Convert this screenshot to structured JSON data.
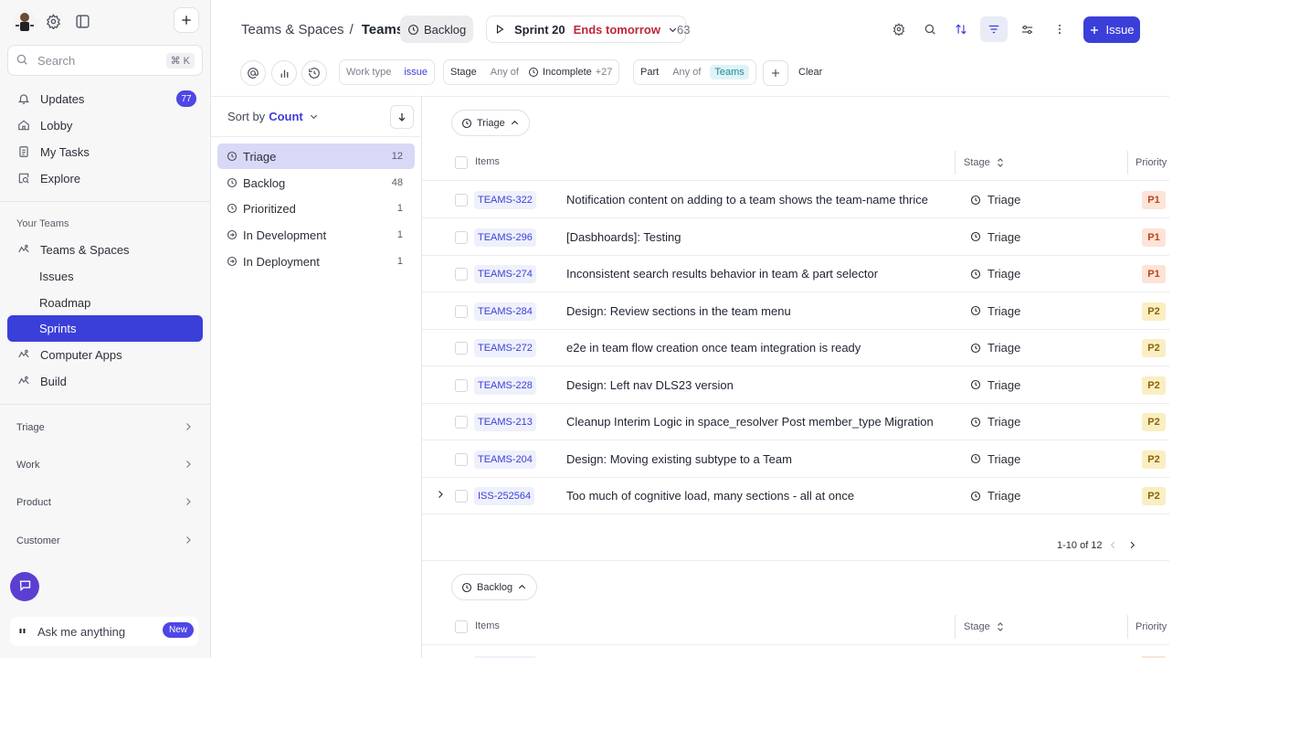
{
  "sidebar": {
    "search_placeholder": "Search",
    "search_shortcut": "⌘ K",
    "nav": [
      {
        "label": "Updates",
        "icon": "bell-icon",
        "badge": "77"
      },
      {
        "label": "Lobby",
        "icon": "home-icon"
      },
      {
        "label": "My Tasks",
        "icon": "clipboard-icon"
      },
      {
        "label": "Explore",
        "icon": "explore-icon"
      }
    ],
    "your_teams_label": "Your Teams",
    "teams": [
      {
        "label": "Teams & Spaces",
        "icon": "team-icon",
        "sub": false,
        "active": false
      },
      {
        "label": "Issues",
        "sub": true,
        "active": false
      },
      {
        "label": "Roadmap",
        "sub": true,
        "active": false
      },
      {
        "label": "Sprints",
        "sub": true,
        "active": true
      },
      {
        "label": "Computer Apps",
        "icon": "team-icon",
        "sub": false,
        "active": false
      },
      {
        "label": "Build",
        "icon": "team-icon",
        "sub": false,
        "active": false
      }
    ],
    "groups": [
      "Triage",
      "Work",
      "Product",
      "Customer"
    ],
    "ask_placeholder": "Ask me anything",
    "ask_badge": "New"
  },
  "header": {
    "breadcrumb_parent": "Teams & Spaces",
    "breadcrumb_separator": "/",
    "breadcrumb_current": "Teams",
    "backlog_label": "Backlog",
    "sprint_name": "Sprint 20",
    "sprint_ends": "Ends tomorrow",
    "sprint_count": "63",
    "issue_button": "Issue"
  },
  "filters": {
    "work_type_label": "Work type",
    "work_type_value": "issue",
    "stage_label": "Stage",
    "stage_op": "Any of",
    "stage_value": "Incomplete",
    "stage_more": "+27",
    "part_label": "Part",
    "part_op": "Any of",
    "part_value": "Teams",
    "clear_label": "Clear"
  },
  "left_panel": {
    "sort_prefix": "Sort by",
    "sort_value": "Count",
    "stages": [
      {
        "label": "Triage",
        "count": "12",
        "selected": true
      },
      {
        "label": "Backlog",
        "count": "48",
        "selected": false
      },
      {
        "label": "Prioritized",
        "count": "1",
        "selected": false
      },
      {
        "label": "In Development",
        "count": "1",
        "selected": false
      },
      {
        "label": "In Deployment",
        "count": "1",
        "selected": false
      }
    ]
  },
  "table": {
    "columns": {
      "items": "Items",
      "stage": "Stage",
      "priority": "Priority"
    },
    "groups": [
      {
        "name": "Triage",
        "rows": [
          {
            "key": "TEAMS-322",
            "title": "Notification content on adding to a team shows the team-name thrice",
            "stage": "Triage",
            "priority": "P1"
          },
          {
            "key": "TEAMS-296",
            "title": "[Dasbhoards]: Testing",
            "stage": "Triage",
            "priority": "P1"
          },
          {
            "key": "TEAMS-274",
            "title": "Inconsistent search results behavior in team & part selector",
            "stage": "Triage",
            "priority": "P1"
          },
          {
            "key": "TEAMS-284",
            "title": "Design: Review sections in the team menu",
            "stage": "Triage",
            "priority": "P2"
          },
          {
            "key": "TEAMS-272",
            "title": "e2e in team flow creation once team integration is ready",
            "stage": "Triage",
            "priority": "P2"
          },
          {
            "key": "TEAMS-228",
            "title": "Design: Left nav DLS23 version",
            "stage": "Triage",
            "priority": "P2"
          },
          {
            "key": "TEAMS-213",
            "title": "Cleanup Interim Logic in space_resolver Post member_type Migration",
            "stage": "Triage",
            "priority": "P2"
          },
          {
            "key": "TEAMS-204",
            "title": "Design: Moving existing subtype to a Team",
            "stage": "Triage",
            "priority": "P2"
          },
          {
            "key": "ISS-252564",
            "title": "Too much of cognitive load, many sections - all at once",
            "stage": "Triage",
            "priority": "P2",
            "expandable": true
          }
        ],
        "pagination": "1-10 of 12"
      },
      {
        "name": "Backlog",
        "rows": []
      }
    ]
  },
  "colors": {
    "accent": "#3b3fd9",
    "p1_bg": "#fde3d8",
    "p2_bg": "#faeec2",
    "danger": "#c0263a"
  }
}
